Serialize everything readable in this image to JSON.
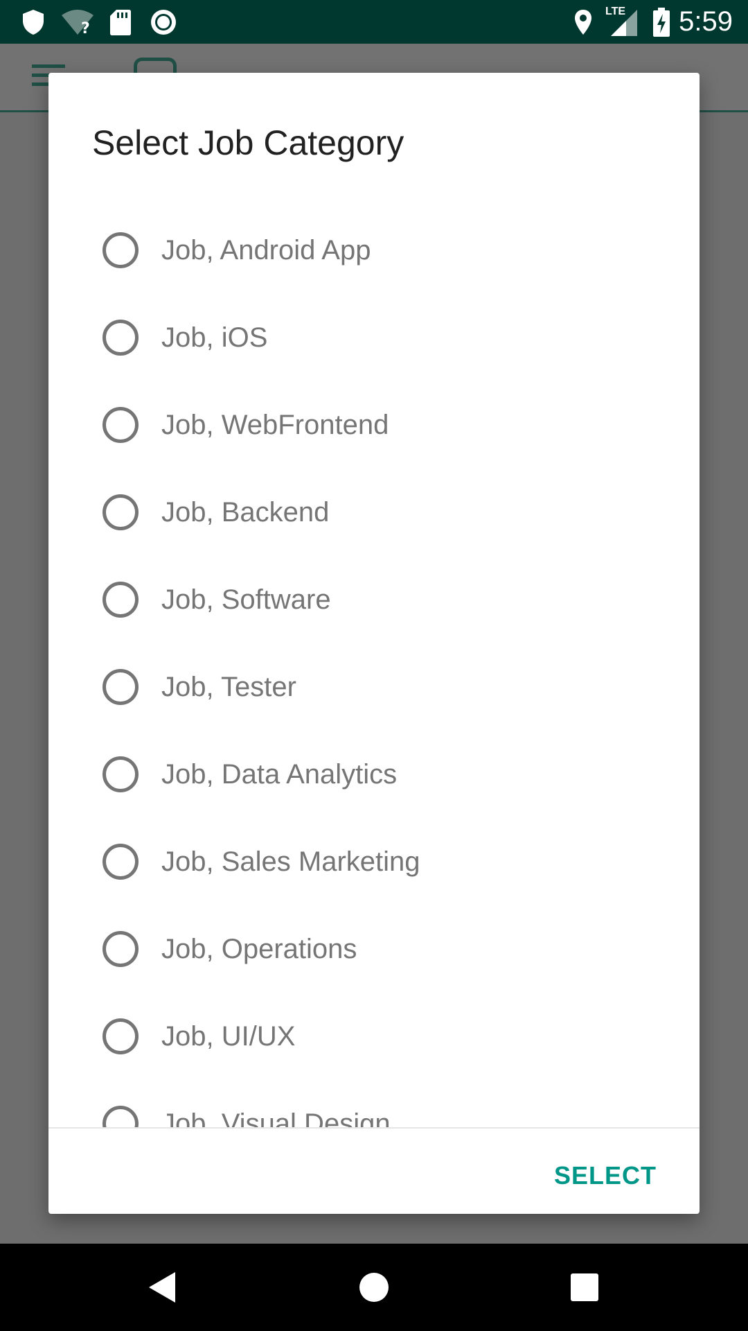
{
  "status_bar": {
    "time": "5:59",
    "network_label": "LTE",
    "icons": [
      "shield-icon",
      "wifi-unknown-icon",
      "sd-card-icon",
      "circle-record-icon",
      "location-icon",
      "signal-icon",
      "battery-charging-icon"
    ]
  },
  "app": {
    "toolbar_icons": [
      "menu-icon",
      "logo-box-icon"
    ]
  },
  "dialog": {
    "title": "Select Job Category",
    "options": [
      {
        "label": "Job, Android App",
        "selected": false
      },
      {
        "label": "Job, iOS",
        "selected": false
      },
      {
        "label": "Job, WebFrontend",
        "selected": false
      },
      {
        "label": "Job, Backend",
        "selected": false
      },
      {
        "label": "Job, Software",
        "selected": false
      },
      {
        "label": "Job, Tester",
        "selected": false
      },
      {
        "label": "Job, Data Analytics",
        "selected": false
      },
      {
        "label": "Job, Sales Marketing",
        "selected": false
      },
      {
        "label": "Job, Operations",
        "selected": false
      },
      {
        "label": "Job, UI/UX",
        "selected": false
      },
      {
        "label": "Job, Visual Design",
        "selected": false
      }
    ],
    "select_label": "SELECT"
  },
  "nav_bar": {
    "buttons": [
      "back-icon",
      "home-icon",
      "recents-icon"
    ]
  },
  "colors": {
    "status_bar_bg": "#00382f",
    "accent": "#009688",
    "scrim": "#6e6e6e",
    "dialog_bg": "#ffffff",
    "title_text": "#212121",
    "option_text": "#757575"
  }
}
